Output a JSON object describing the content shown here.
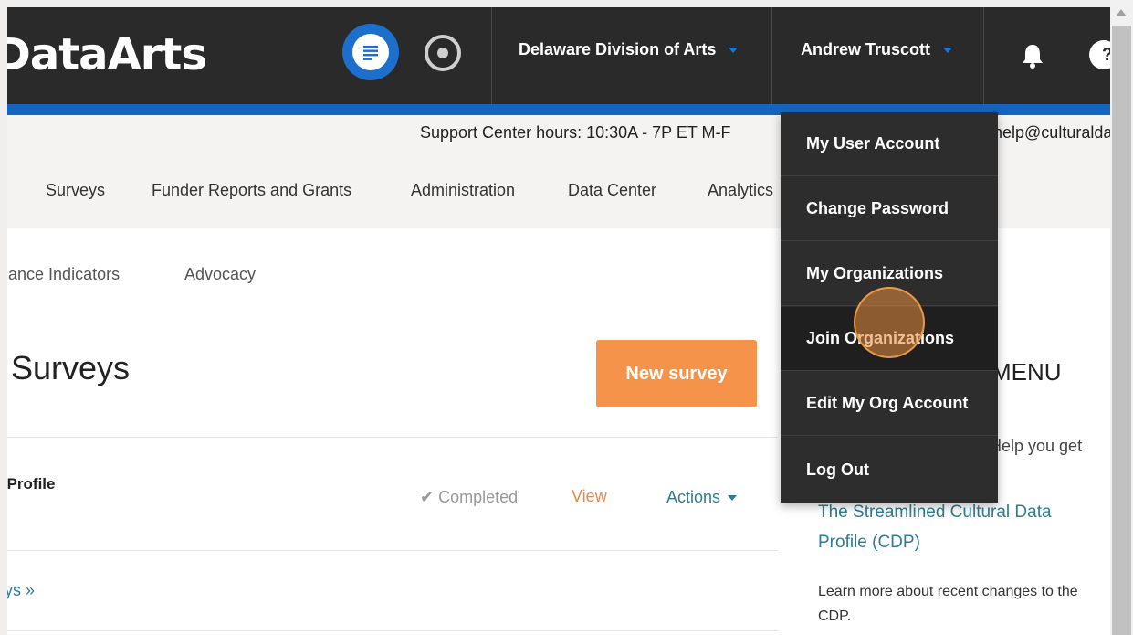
{
  "header": {
    "logo_text": "DataArts",
    "org_name": "Delaware Division of Arts",
    "user_name": "Andrew Truscott",
    "help_symbol": "?",
    "icons": [
      "list-icon",
      "target-icon",
      "bell-icon",
      "help-icon"
    ]
  },
  "support_bar": {
    "hours_text": "Support Center hours: 10:30A - 7P ET M-F",
    "email_text": "help@culturaldata"
  },
  "main_nav": {
    "items": [
      {
        "label": "Surveys"
      },
      {
        "label": "Funder Reports and Grants"
      },
      {
        "label": "Administration"
      },
      {
        "label": "Data Center"
      },
      {
        "label": "Analytics"
      }
    ]
  },
  "sub_nav": {
    "items": [
      {
        "label": "Performance Indicators"
      },
      {
        "label": "Advocacy"
      }
    ]
  },
  "main": {
    "title": "Surveys",
    "new_survey_label": "New survey",
    "survey_row": {
      "title": "Data Profile",
      "status": "✔ Completed",
      "view_label": "View",
      "actions_label": "Actions"
    },
    "more_link": "All surveys »"
  },
  "sidebar": {
    "heading": "MENU",
    "text1": "Help you get",
    "link": "The Streamlined Cultural Data Profile (CDP)",
    "text2": "Learn more about recent changes to the CDP."
  },
  "user_menu": {
    "items": [
      {
        "label": "My User Account"
      },
      {
        "label": "Change Password"
      },
      {
        "label": "My Organizations"
      },
      {
        "label": "Join Organizations"
      },
      {
        "label": "Edit My Org Account"
      },
      {
        "label": "Log Out"
      }
    ],
    "hovered": "Join Organizations"
  },
  "colors": {
    "topbar": "#2a2a2a",
    "accent_blue": "#1565c0",
    "orange": "#f6934a",
    "link_teal": "#2e7d95"
  }
}
